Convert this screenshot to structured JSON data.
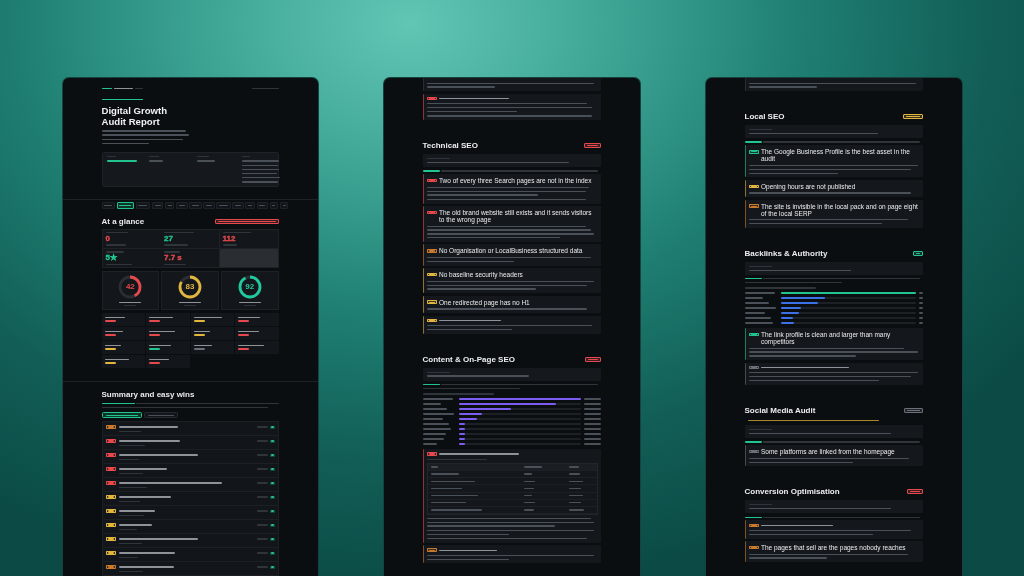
{
  "report_pages": [
    {
      "kind": "cover",
      "title": "Digital Growth Audit Report",
      "nav_tabs": [
        {
          "selected": false
        },
        {
          "selected": true
        },
        {
          "selected": false
        },
        {
          "selected": false
        },
        {
          "selected": false
        },
        {
          "selected": false
        },
        {
          "selected": false
        },
        {
          "selected": false
        },
        {
          "selected": false
        },
        {
          "selected": false
        },
        {
          "selected": false
        },
        {
          "selected": false
        },
        {
          "selected": false
        },
        {
          "selected": false
        }
      ],
      "glance": {
        "heading": "At a glance",
        "flag": {
          "color": "#e5484d"
        },
        "stats": [
          {
            "value": "0",
            "color": "#e5484d"
          },
          {
            "value": "27",
            "color": "#21c48d"
          },
          {
            "value": "112",
            "color": "#e5484d"
          },
          {
            "value": "5★",
            "color": "#21c48d"
          },
          {
            "value": "7.7 s",
            "color": "#e5484d"
          }
        ],
        "scores": [
          {
            "value": "42",
            "color": "#e5484d"
          },
          {
            "value": "83",
            "color": "#e2b53e"
          },
          {
            "value": "92",
            "color": "#21c9a0"
          }
        ],
        "categories": [
          {
            "color": "#e5484d"
          },
          {
            "color": "#e5484d"
          },
          {
            "color": "#e2b53e"
          },
          {
            "color": "#e5484d"
          },
          {
            "color": "#e5484d"
          },
          {
            "color": "#e5484d"
          },
          {
            "color": "#e2b53e"
          },
          {
            "color": "#e5484d"
          },
          {
            "color": "#e2b53e"
          },
          {
            "color": "#21c48d"
          },
          {
            "color": "#6b7178"
          },
          {
            "color": "#e5484d"
          },
          {
            "color": "#e2b53e"
          },
          {
            "color": "#e5484d"
          }
        ]
      },
      "summary": {
        "heading": "Summary and easy wins",
        "tabs": [
          {
            "selected": true
          },
          {
            "selected": false
          }
        ],
        "rows": [
          {
            "color": "#c97a2c"
          },
          {
            "color": "#e5484d"
          },
          {
            "color": "#e5484d"
          },
          {
            "color": "#e5484d"
          },
          {
            "color": "#e5484d"
          },
          {
            "color": "#e2b53e"
          },
          {
            "color": "#e2b53e"
          },
          {
            "color": "#e2b53e"
          },
          {
            "color": "#e2b53e"
          },
          {
            "color": "#e2b53e"
          },
          {
            "color": "#c97a2c"
          }
        ]
      }
    },
    {
      "kind": "report",
      "blocks": [
        {
          "kind": "card_tail"
        },
        {
          "kind": "issue",
          "color": "#e5484d"
        },
        {
          "kind": "section",
          "heading": "Technical SEO",
          "color": "#e5484d"
        },
        {
          "kind": "note"
        },
        {
          "kind": "lead"
        },
        {
          "kind": "issue",
          "color": "#e5484d",
          "title": "Two of every three Search pages are not in the index"
        },
        {
          "kind": "issue",
          "color": "#e5484d",
          "title": "The old brand website still exists and it sends visitors to the wrong page"
        },
        {
          "kind": "issue",
          "color": "#c97a2c",
          "title": "No Organisation or LocalBusiness structured data"
        },
        {
          "kind": "issue",
          "color": "#e2b53e",
          "title": "No baseline security headers"
        },
        {
          "kind": "issue",
          "color": "#e2b53e",
          "title": "One redirected page has no H1"
        },
        {
          "kind": "issue",
          "color": "#e2b53e"
        },
        {
          "kind": "section",
          "heading": "Content & On-Page SEO",
          "color": "#e5484d"
        },
        {
          "kind": "note"
        },
        {
          "kind": "lead"
        },
        {
          "kind": "bar_chart"
        },
        {
          "kind": "table_issue",
          "color": "#e5484d"
        },
        {
          "kind": "issue",
          "color": "#c97a2c"
        }
      ]
    },
    {
      "kind": "report",
      "blocks": [
        {
          "kind": "card_tail"
        },
        {
          "kind": "section",
          "heading": "Local SEO",
          "color": "#e2b53e"
        },
        {
          "kind": "note"
        },
        {
          "kind": "lead"
        },
        {
          "kind": "issue",
          "color": "#21c48d",
          "title": "The Google Business Profile is the best asset in the audit"
        },
        {
          "kind": "issue",
          "color": "#e2b53e",
          "title": "Opening hours are not published"
        },
        {
          "kind": "issue",
          "color": "#c97a2c",
          "title": "The site is invisible in the local pack and on page eight of the local SERP"
        },
        {
          "kind": "section",
          "heading": "Backlinks & Authority",
          "color": "#21c48d"
        },
        {
          "kind": "note"
        },
        {
          "kind": "lead"
        },
        {
          "kind": "bar_chart"
        },
        {
          "kind": "issue",
          "color": "#21c48d",
          "title": "The link profile is clean and larger than many competitors"
        },
        {
          "kind": "issue",
          "color": "#6b7178"
        },
        {
          "kind": "section",
          "heading": "Social Media Audit",
          "color": "#6b7178"
        },
        {
          "kind": "warning"
        },
        {
          "kind": "note"
        },
        {
          "kind": "lead"
        },
        {
          "kind": "issue",
          "color": "#6b7178",
          "title": "Some platforms are linked from the homepage"
        },
        {
          "kind": "section",
          "heading": "Conversion Optimisation",
          "color": "#e5484d"
        },
        {
          "kind": "note"
        },
        {
          "kind": "lead"
        },
        {
          "kind": "issue",
          "color": "#c97a2c"
        },
        {
          "kind": "issue",
          "color": "#c97a2c",
          "title": "The pages that sell are the pages nobody reaches"
        }
      ]
    }
  ]
}
